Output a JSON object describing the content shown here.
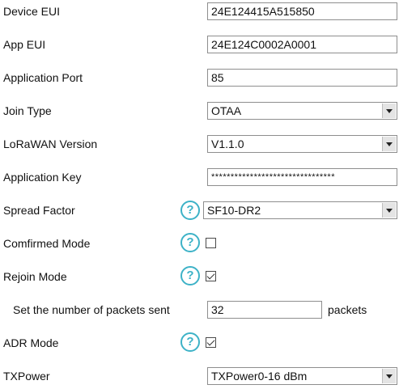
{
  "fields": {
    "device_eui": {
      "label": "Device EUI",
      "value": "24E124415A515850"
    },
    "app_eui": {
      "label": "App EUI",
      "value": "24E124C0002A0001"
    },
    "application_port": {
      "label": "Application Port",
      "value": "85"
    },
    "join_type": {
      "label": "Join Type",
      "value": "OTAA"
    },
    "lorawan_version": {
      "label": "LoRaWAN Version",
      "value": "V1.1.0"
    },
    "application_key": {
      "label": "Application Key",
      "value": "********************************"
    },
    "spread_factor": {
      "label": "Spread Factor",
      "value": "SF10-DR2"
    },
    "confirmed_mode": {
      "label": "Comfirmed Mode",
      "checked": false
    },
    "rejoin_mode": {
      "label": "Rejoin Mode",
      "checked": true
    },
    "packets_sent": {
      "label": "Set the number of packets sent",
      "value": "32",
      "unit": "packets"
    },
    "adr_mode": {
      "label": "ADR Mode",
      "checked": true
    },
    "txpower": {
      "label": "TXPower",
      "value": "TXPower0-16 dBm"
    }
  },
  "help_icon": {
    "glyph": "?",
    "color": "#3db2c7"
  }
}
